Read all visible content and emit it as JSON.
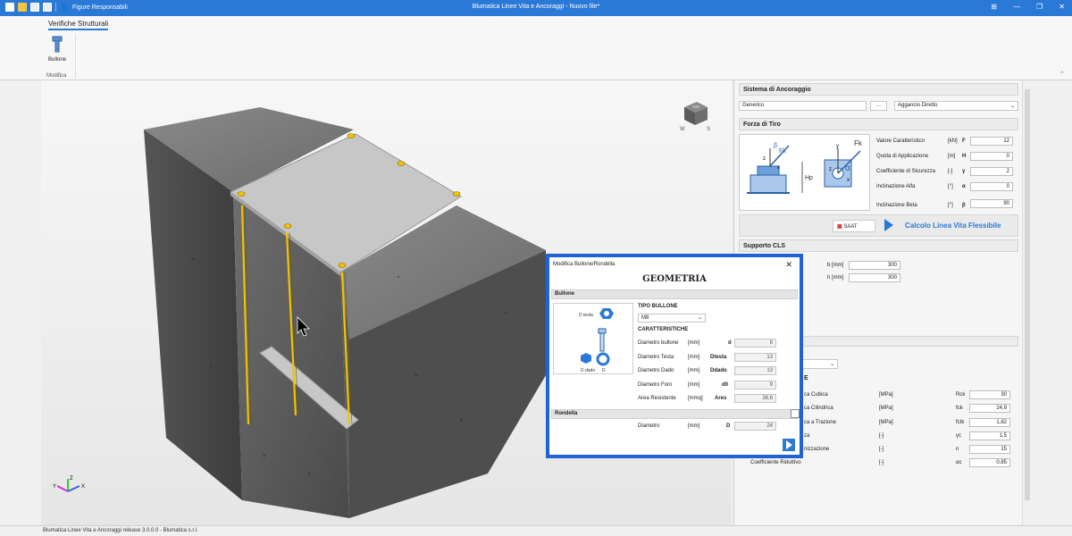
{
  "window": {
    "title": "Blumatica Linee Vita e Ancoraggi - Nuovo file*",
    "toolbar_label": "Figure Responsabili",
    "controls": [
      "⊞",
      "—",
      "❐",
      "✕"
    ]
  },
  "ribbon": {
    "tab": "Verifiche Strutturali",
    "button": "Bullone",
    "group": "Modifica"
  },
  "panel": {
    "sistema": {
      "header": "Sistema di Ancoraggio",
      "tipo": "Generico",
      "dots": "...",
      "aggancio": "Aggancio Diretto"
    },
    "forza": {
      "header": "Forza di Tiro",
      "rows": [
        {
          "label": "Valore Caratteristico",
          "unit": "[kN]",
          "sym": "F",
          "value": "12"
        },
        {
          "label": "Quota di Applicazione",
          "unit": "[m]",
          "sym": "H",
          "value": "0"
        },
        {
          "label": "Coefficiente di Sicurezza",
          "unit": "[-]",
          "sym": "γ",
          "value": "2"
        },
        {
          "label": "Inclinazione Alfa",
          "unit": "[°]",
          "sym": "α",
          "value": "0"
        },
        {
          "label": "Inclinazione Beta",
          "unit": "[°]",
          "sym": "β",
          "value": "90"
        }
      ],
      "diagram_labels": {
        "fk": "Fk",
        "hp": "Hp",
        "z": "z",
        "x": "x",
        "y": "y",
        "alpha": "α",
        "beta": "β"
      },
      "saat": "SAAT",
      "calcolo": "Calcolo Linea Vita Flessibile"
    },
    "supporto": {
      "header": "Supporto CLS",
      "b_label": "b [mm]",
      "b_value": "300",
      "h_label": "h [mm]",
      "h_value": "300"
    },
    "materiale": {
      "rows": [
        {
          "label": "ca Cubica",
          "unit": "[MPa]",
          "sym": "Rck",
          "value": "30"
        },
        {
          "label": "ca Cilindrica",
          "unit": "[MPa]",
          "sym": "fck",
          "value": "24,9"
        },
        {
          "label": "ca a Trazione",
          "unit": "[MPa]",
          "sym": "fctk",
          "value": "1,82"
        },
        {
          "label": "za",
          "unit": "[-]",
          "sym": "γc",
          "value": "1,5"
        },
        {
          "label": "nizzazione",
          "unit": "[-]",
          "sym": "n",
          "value": "15"
        },
        {
          "label": "Coefficiente Riduttivo",
          "unit": "[-]",
          "sym": "αc",
          "value": "0,85"
        }
      ],
      "partial_e": "E"
    }
  },
  "dialog": {
    "title": "Modifica Bullone/Rondella",
    "close": "✕",
    "heading": "GEOMETRIA",
    "bullone": {
      "header": "Bullone",
      "tipo_label": "TIPO BULLONE",
      "tipo_value": "M8",
      "caratt_label": "CARATTERISTICHE",
      "img_labels": {
        "dtesta": "D testa",
        "ddado": "D dado",
        "d": "D"
      },
      "rows": [
        {
          "label": "Diametro bullone",
          "unit": "[mm]",
          "sym": "d",
          "value": "8"
        },
        {
          "label": "Diametro Testa",
          "unit": "[mm]",
          "sym": "Dtesta",
          "value": "13"
        },
        {
          "label": "Diametro Dado",
          "unit": "[mm]",
          "sym": "Ddado",
          "value": "13"
        },
        {
          "label": "Diametro Foro",
          "unit": "[mm]",
          "sym": "d0",
          "value": "9"
        },
        {
          "label": "Area Resistente",
          "unit": "[mmq]",
          "sym": "Ares",
          "value": "38,6"
        }
      ]
    },
    "rondella": {
      "header": "Rondella",
      "row": {
        "label": "Diametro",
        "unit": "[mm]",
        "sym": "D",
        "value": "24"
      }
    }
  },
  "viewcube": {
    "top": "TOP",
    "w": "W",
    "s": "S"
  },
  "axes": {
    "x": "X",
    "y": "Y",
    "z": "Z"
  },
  "status": "Blumatica Linee Vita e Ancoraggi release 3.0.0.0 - Blumatica s.r.l.",
  "colors": {
    "accent": "#2b79d6",
    "dialog_border": "#1f63d6",
    "bolt": "#f2c200"
  }
}
